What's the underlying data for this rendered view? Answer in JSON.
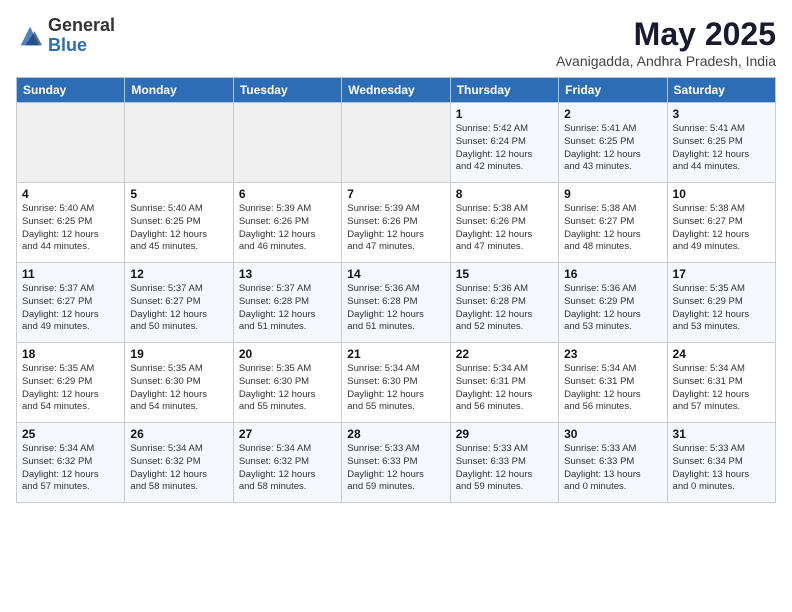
{
  "header": {
    "logo_general": "General",
    "logo_blue": "Blue",
    "month_title": "May 2025",
    "location": "Avanigadda, Andhra Pradesh, India"
  },
  "weekdays": [
    "Sunday",
    "Monday",
    "Tuesday",
    "Wednesday",
    "Thursday",
    "Friday",
    "Saturday"
  ],
  "weeks": [
    [
      {
        "day": "",
        "info": ""
      },
      {
        "day": "",
        "info": ""
      },
      {
        "day": "",
        "info": ""
      },
      {
        "day": "",
        "info": ""
      },
      {
        "day": "1",
        "info": "Sunrise: 5:42 AM\nSunset: 6:24 PM\nDaylight: 12 hours\nand 42 minutes."
      },
      {
        "day": "2",
        "info": "Sunrise: 5:41 AM\nSunset: 6:25 PM\nDaylight: 12 hours\nand 43 minutes."
      },
      {
        "day": "3",
        "info": "Sunrise: 5:41 AM\nSunset: 6:25 PM\nDaylight: 12 hours\nand 44 minutes."
      }
    ],
    [
      {
        "day": "4",
        "info": "Sunrise: 5:40 AM\nSunset: 6:25 PM\nDaylight: 12 hours\nand 44 minutes."
      },
      {
        "day": "5",
        "info": "Sunrise: 5:40 AM\nSunset: 6:25 PM\nDaylight: 12 hours\nand 45 minutes."
      },
      {
        "day": "6",
        "info": "Sunrise: 5:39 AM\nSunset: 6:26 PM\nDaylight: 12 hours\nand 46 minutes."
      },
      {
        "day": "7",
        "info": "Sunrise: 5:39 AM\nSunset: 6:26 PM\nDaylight: 12 hours\nand 47 minutes."
      },
      {
        "day": "8",
        "info": "Sunrise: 5:38 AM\nSunset: 6:26 PM\nDaylight: 12 hours\nand 47 minutes."
      },
      {
        "day": "9",
        "info": "Sunrise: 5:38 AM\nSunset: 6:27 PM\nDaylight: 12 hours\nand 48 minutes."
      },
      {
        "day": "10",
        "info": "Sunrise: 5:38 AM\nSunset: 6:27 PM\nDaylight: 12 hours\nand 49 minutes."
      }
    ],
    [
      {
        "day": "11",
        "info": "Sunrise: 5:37 AM\nSunset: 6:27 PM\nDaylight: 12 hours\nand 49 minutes."
      },
      {
        "day": "12",
        "info": "Sunrise: 5:37 AM\nSunset: 6:27 PM\nDaylight: 12 hours\nand 50 minutes."
      },
      {
        "day": "13",
        "info": "Sunrise: 5:37 AM\nSunset: 6:28 PM\nDaylight: 12 hours\nand 51 minutes."
      },
      {
        "day": "14",
        "info": "Sunrise: 5:36 AM\nSunset: 6:28 PM\nDaylight: 12 hours\nand 51 minutes."
      },
      {
        "day": "15",
        "info": "Sunrise: 5:36 AM\nSunset: 6:28 PM\nDaylight: 12 hours\nand 52 minutes."
      },
      {
        "day": "16",
        "info": "Sunrise: 5:36 AM\nSunset: 6:29 PM\nDaylight: 12 hours\nand 53 minutes."
      },
      {
        "day": "17",
        "info": "Sunrise: 5:35 AM\nSunset: 6:29 PM\nDaylight: 12 hours\nand 53 minutes."
      }
    ],
    [
      {
        "day": "18",
        "info": "Sunrise: 5:35 AM\nSunset: 6:29 PM\nDaylight: 12 hours\nand 54 minutes."
      },
      {
        "day": "19",
        "info": "Sunrise: 5:35 AM\nSunset: 6:30 PM\nDaylight: 12 hours\nand 54 minutes."
      },
      {
        "day": "20",
        "info": "Sunrise: 5:35 AM\nSunset: 6:30 PM\nDaylight: 12 hours\nand 55 minutes."
      },
      {
        "day": "21",
        "info": "Sunrise: 5:34 AM\nSunset: 6:30 PM\nDaylight: 12 hours\nand 55 minutes."
      },
      {
        "day": "22",
        "info": "Sunrise: 5:34 AM\nSunset: 6:31 PM\nDaylight: 12 hours\nand 56 minutes."
      },
      {
        "day": "23",
        "info": "Sunrise: 5:34 AM\nSunset: 6:31 PM\nDaylight: 12 hours\nand 56 minutes."
      },
      {
        "day": "24",
        "info": "Sunrise: 5:34 AM\nSunset: 6:31 PM\nDaylight: 12 hours\nand 57 minutes."
      }
    ],
    [
      {
        "day": "25",
        "info": "Sunrise: 5:34 AM\nSunset: 6:32 PM\nDaylight: 12 hours\nand 57 minutes."
      },
      {
        "day": "26",
        "info": "Sunrise: 5:34 AM\nSunset: 6:32 PM\nDaylight: 12 hours\nand 58 minutes."
      },
      {
        "day": "27",
        "info": "Sunrise: 5:34 AM\nSunset: 6:32 PM\nDaylight: 12 hours\nand 58 minutes."
      },
      {
        "day": "28",
        "info": "Sunrise: 5:33 AM\nSunset: 6:33 PM\nDaylight: 12 hours\nand 59 minutes."
      },
      {
        "day": "29",
        "info": "Sunrise: 5:33 AM\nSunset: 6:33 PM\nDaylight: 12 hours\nand 59 minutes."
      },
      {
        "day": "30",
        "info": "Sunrise: 5:33 AM\nSunset: 6:33 PM\nDaylight: 13 hours\nand 0 minutes."
      },
      {
        "day": "31",
        "info": "Sunrise: 5:33 AM\nSunset: 6:34 PM\nDaylight: 13 hours\nand 0 minutes."
      }
    ]
  ]
}
